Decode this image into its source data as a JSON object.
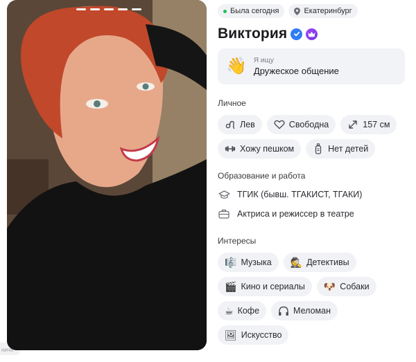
{
  "status": {
    "online": "Была сегодня",
    "city": "Екатеринбург"
  },
  "profile": {
    "name": "Виктория"
  },
  "looking_for": {
    "label": "Я ищу",
    "value": "Дружеское общение"
  },
  "personal": {
    "title": "Личное",
    "chips": [
      {
        "icon": "zodiac-leo-icon",
        "label": "Лев"
      },
      {
        "icon": "heart-icon",
        "label": "Свободна"
      },
      {
        "icon": "height-arrows-icon",
        "label": "157 см"
      },
      {
        "icon": "dumbbell-icon",
        "label": "Хожу пешком"
      },
      {
        "icon": "bottle-icon",
        "label": "Нет детей"
      }
    ]
  },
  "education_work": {
    "title": "Образование и работа",
    "education": "ТГИК (бывш. ТГАКИСТ, ТГАКИ)",
    "work": "Актриса и режиссер в театре"
  },
  "interests": {
    "title": "Интересы",
    "items": [
      {
        "icon": "🎼",
        "label": "Музыка"
      },
      {
        "icon": "🕵",
        "label": "Детективы"
      },
      {
        "icon": "🎬",
        "label": "Кино и сериалы"
      },
      {
        "icon": "🐶",
        "label": "Собаки"
      },
      {
        "icon": "☕",
        "label": "Кофе"
      },
      {
        "icon": "headphones-icon",
        "label": "Меломан"
      },
      {
        "icon": "🖼",
        "label": "Искусство"
      }
    ]
  },
  "side_tab": "ниче"
}
